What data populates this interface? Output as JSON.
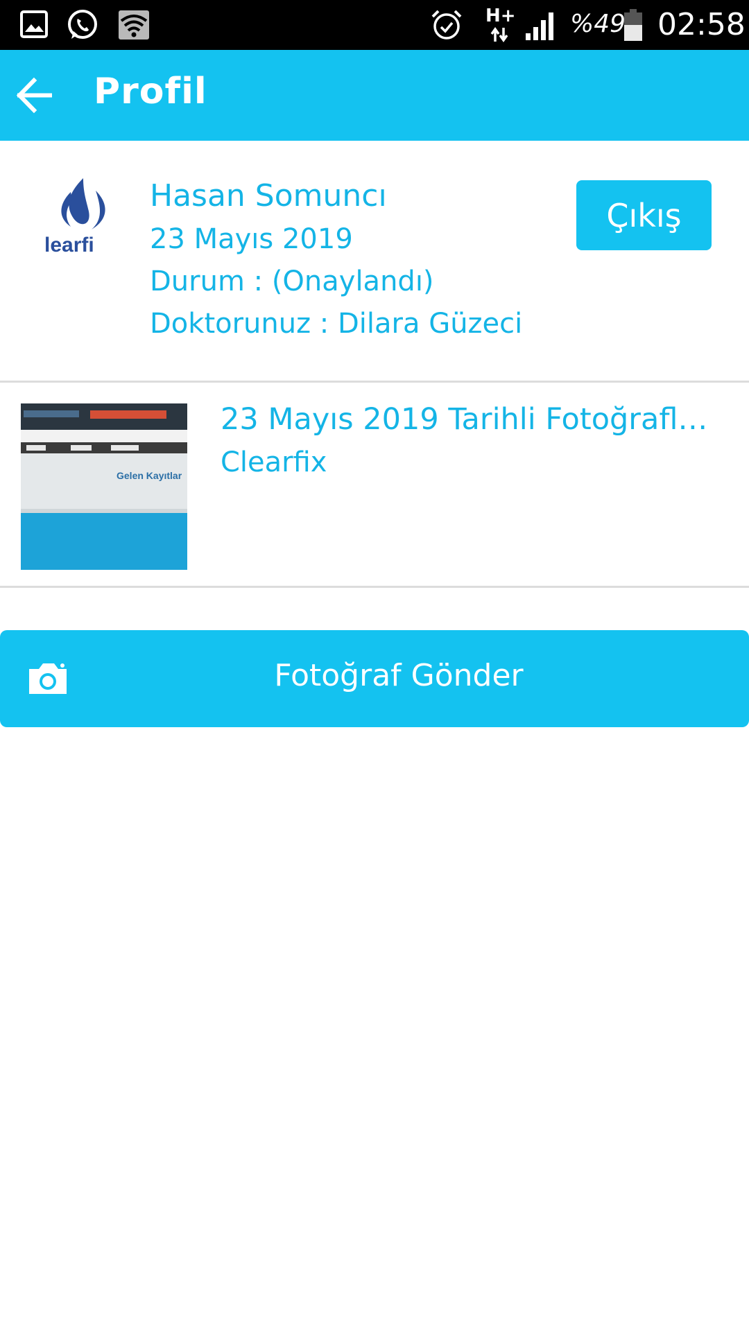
{
  "status_bar": {
    "network": "H+",
    "battery": "%49",
    "time": "02:58",
    "icons": [
      "gallery-icon",
      "whatsapp-icon",
      "wifi-icon",
      "alarm-icon",
      "network-arrows-icon",
      "signal-icon",
      "battery-icon"
    ]
  },
  "app_bar": {
    "title": "Profil",
    "back_icon": "arrow-left-icon"
  },
  "profile": {
    "logo_text": "learfi",
    "name": "Hasan Somuncı",
    "date": "23 Mayıs 2019",
    "status": "Durum : (Onaylandı)",
    "doctor": "Doktorunuz : Dilara Güzeci",
    "logout_label": "Çıkış"
  },
  "photos": [
    {
      "title": "23 Mayıs 2019 Tarihli Fotoğrafl…",
      "subtitle": "Clearfix",
      "thumb_text": "Gelen Kayıtlar"
    }
  ],
  "send_button": {
    "label": "Fotoğraf Gönder",
    "icon": "camera-icon"
  },
  "colors": {
    "accent": "#14c2f0",
    "text_accent": "#14b4e6",
    "logo": "#2a4f9c",
    "status_bar": "#000000",
    "divider": "#dcdcdc"
  }
}
